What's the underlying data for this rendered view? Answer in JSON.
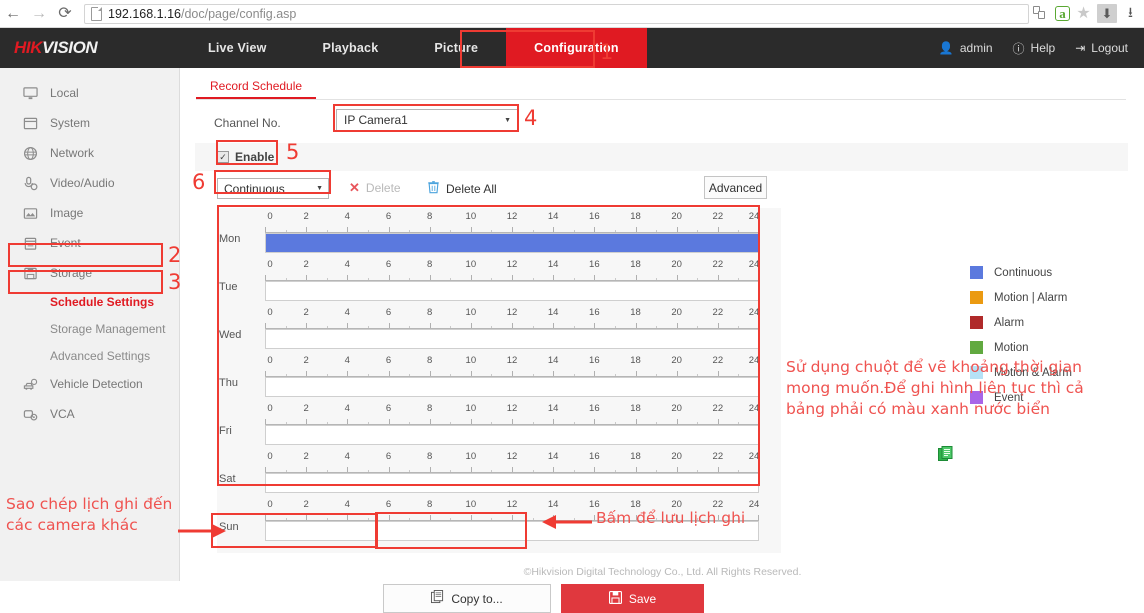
{
  "browser": {
    "url_host": "192.168.1.16",
    "url_path": "/doc/page/config.asp",
    "back_icon": "back-arrow-icon",
    "forward_icon": "forward-arrow-icon",
    "reload_icon": "reload-icon",
    "page_icon": "page-icon",
    "extension_icons": [
      "tab-pages-icon",
      "adblock-icon",
      "bookmark-star-icon",
      "download-active-icon",
      "download-icon"
    ]
  },
  "header": {
    "logo_hik": "HIK",
    "logo_vision": "VISION",
    "tabs": [
      {
        "label": "Live View",
        "active": false
      },
      {
        "label": "Playback",
        "active": false
      },
      {
        "label": "Picture",
        "active": false
      },
      {
        "label": "Configuration",
        "active": true
      }
    ],
    "user": "admin",
    "help": "Help",
    "logout": "Logout"
  },
  "sidebar": {
    "items": [
      {
        "label": "Local",
        "icon": "monitor-icon"
      },
      {
        "label": "System",
        "icon": "window-icon"
      },
      {
        "label": "Network",
        "icon": "globe-icon"
      },
      {
        "label": "Video/Audio",
        "icon": "microphone-icon"
      },
      {
        "label": "Image",
        "icon": "picture-icon"
      },
      {
        "label": "Event",
        "icon": "calendar-icon"
      },
      {
        "label": "Storage",
        "icon": "floppy-disk-icon"
      }
    ],
    "sub_items": [
      {
        "label": "Schedule Settings",
        "active": true
      },
      {
        "label": "Storage Management",
        "active": false
      },
      {
        "label": "Advanced Settings",
        "active": false
      }
    ],
    "items_after": [
      {
        "label": "Vehicle Detection",
        "icon": "car-search-icon"
      },
      {
        "label": "VCA",
        "icon": "gear-camera-icon"
      }
    ]
  },
  "main": {
    "tab_label": "Record Schedule",
    "channel_label": "Channel No.",
    "channel_value": "IP Camera1",
    "enable_label": "Enable",
    "enable_checked": true,
    "type_value": "Continuous",
    "delete_label": "Delete",
    "delete_all_label": "Delete All",
    "advanced_label": "Advanced",
    "copy_to_label": "Copy to...",
    "save_label": "Save",
    "copy_icon": "copy-icon",
    "save_icon": "floppy-disk-icon",
    "delete_icon": "x-icon",
    "delete_all_icon": "trash-icon",
    "green_icon": "copy-sheet-icon"
  },
  "schedule": {
    "hour_ticks": [
      0,
      2,
      4,
      6,
      8,
      10,
      12,
      14,
      16,
      18,
      20,
      22,
      24
    ],
    "days": [
      {
        "label": "Mon",
        "fill_start": 0,
        "fill_end": 24,
        "fill_color": "#5b79de"
      },
      {
        "label": "Tue",
        "fill_start": 0,
        "fill_end": 0,
        "fill_color": "#5b79de"
      },
      {
        "label": "Wed",
        "fill_start": 0,
        "fill_end": 0,
        "fill_color": "#5b79de"
      },
      {
        "label": "Thu",
        "fill_start": 0,
        "fill_end": 0,
        "fill_color": "#5b79de"
      },
      {
        "label": "Fri",
        "fill_start": 0,
        "fill_end": 0,
        "fill_color": "#5b79de"
      },
      {
        "label": "Sat",
        "fill_start": 0,
        "fill_end": 0,
        "fill_color": "#5b79de"
      },
      {
        "label": "Sun",
        "fill_start": 0,
        "fill_end": 0,
        "fill_color": "#5b79de"
      }
    ]
  },
  "legend": [
    {
      "label": "Continuous",
      "color": "#5b79de"
    },
    {
      "label": "Motion | Alarm",
      "color": "#eb9a11"
    },
    {
      "label": "Alarm",
      "color": "#b02a2a"
    },
    {
      "label": "Motion",
      "color": "#61a940"
    },
    {
      "label": "Motion & Alarm",
      "color": "#b6e2f7"
    },
    {
      "label": "Event",
      "color": "#a865e8"
    }
  ],
  "annotations": {
    "numbers": [
      "1",
      "2",
      "3",
      "4",
      "5",
      "6"
    ],
    "note_right": "Sử dụng chuột để vẽ khoảng thời gian\nmong muốn.Để ghi hình liên tục thì cả\nbảng phải có màu xanh nước biển",
    "note_left": "Sao chép lịch ghi đến\ncác camera khác",
    "note_save": "Bấm để lưu lịch ghi",
    "color": "#ef3b33"
  },
  "footer": {
    "text": "©Hikvision Digital Technology Co., Ltd. All Rights Reserved."
  }
}
